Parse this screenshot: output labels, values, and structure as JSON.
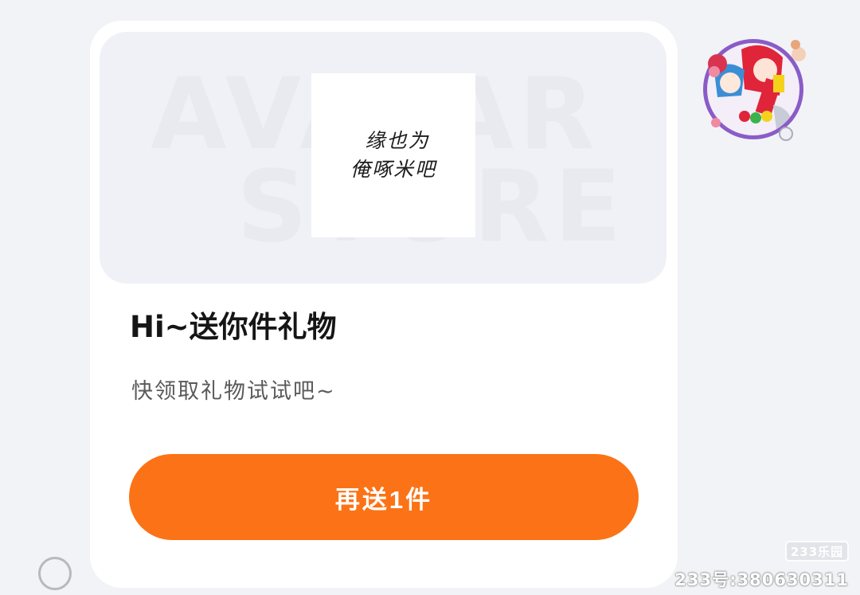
{
  "card": {
    "banner_bg_words": [
      "AVATAR",
      "STORE"
    ],
    "gift_image_text": [
      "缘也为",
      "俺啄米吧"
    ],
    "title": "Hi~送你件礼物",
    "subtitle": "快领取礼物试试吧~",
    "button_label": "再送1件"
  },
  "avatar": {
    "icon": "anime-avatar-with-rose-frame"
  },
  "watermark": {
    "logo": "233乐园",
    "text": "233号:380630311"
  },
  "colors": {
    "background": "#f2f3f7",
    "card": "#ffffff",
    "accent": "#fb7316"
  }
}
